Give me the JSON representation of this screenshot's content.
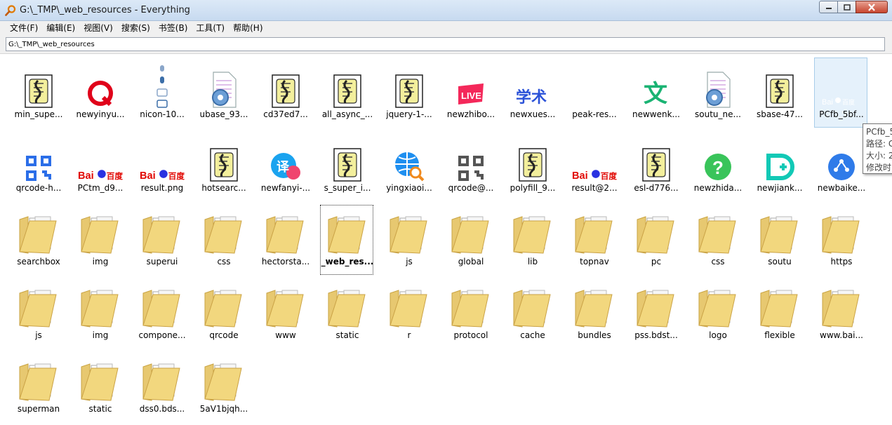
{
  "window": {
    "title": "G:\\_TMP\\_web_resources - Everything",
    "accent": "#c7daf0"
  },
  "menu": [
    {
      "label": "文件(F)"
    },
    {
      "label": "编辑(E)"
    },
    {
      "label": "视图(V)"
    },
    {
      "label": "搜索(S)"
    },
    {
      "label": "书签(B)"
    },
    {
      "label": "工具(T)"
    },
    {
      "label": "帮助(H)"
    }
  ],
  "search": {
    "value": "G:\\_TMP\\_web_resources"
  },
  "rows": [
    [
      {
        "name": "min_supe...",
        "icon": "script-icon"
      },
      {
        "name": "newyinyu...",
        "icon": "music-q-icon"
      },
      {
        "name": "nicon-10...",
        "icon": "icon-sprite"
      },
      {
        "name": "ubase_93...",
        "icon": "gear-doc-icon"
      },
      {
        "name": "cd37ed7...",
        "icon": "script-icon"
      },
      {
        "name": "all_async_...",
        "icon": "script-icon"
      },
      {
        "name": "jquery-1-...",
        "icon": "script-icon"
      },
      {
        "name": "newzhibo...",
        "icon": "live-icon"
      },
      {
        "name": "newxues...",
        "icon": "xueshu-icon"
      },
      {
        "name": "peak-res...",
        "icon": "blank-icon"
      },
      {
        "name": "newwenk...",
        "icon": "wenku-icon"
      },
      {
        "name": "soutu_ne...",
        "icon": "gear-doc-icon"
      },
      {
        "name": "sbase-47...",
        "icon": "script-icon"
      },
      {
        "name": "PCfb_5bf...",
        "icon": "baidu-white-icon",
        "state": "hovered"
      }
    ],
    [
      {
        "name": "qrcode-h...",
        "icon": "qrcode-blue-icon"
      },
      {
        "name": "PCtm_d9...",
        "icon": "baidu-logo-icon"
      },
      {
        "name": "result.png",
        "icon": "baidu-logo-icon"
      },
      {
        "name": "hotsearc...",
        "icon": "script-icon"
      },
      {
        "name": "newfanyi-...",
        "icon": "fanyi-icon"
      },
      {
        "name": "s_super_i...",
        "icon": "script-icon"
      },
      {
        "name": "yingxiaoi...",
        "icon": "globe-search-icon"
      },
      {
        "name": "qrcode@...",
        "icon": "qrcode-gray-icon"
      },
      {
        "name": "polyfill_9...",
        "icon": "script-icon"
      },
      {
        "name": "result@2...",
        "icon": "baidu-logo-icon"
      },
      {
        "name": "esl-d776...",
        "icon": "script-icon"
      },
      {
        "name": "newzhida...",
        "icon": "zhidao-icon"
      },
      {
        "name": "newjiank...",
        "icon": "jiankang-icon"
      },
      {
        "name": "newbaike...",
        "icon": "baike-icon"
      }
    ],
    [
      {
        "name": "searchbox",
        "icon": "folder-icon"
      },
      {
        "name": "img",
        "icon": "folder-icon"
      },
      {
        "name": "superui",
        "icon": "folder-icon"
      },
      {
        "name": "css",
        "icon": "folder-doc-icon"
      },
      {
        "name": "hectorsta...",
        "icon": "folder-doc-icon"
      },
      {
        "name": "_web_res...",
        "icon": "folder-icon",
        "state": "selected"
      },
      {
        "name": "js",
        "icon": "folder-doc-icon"
      },
      {
        "name": "global",
        "icon": "folder-icon"
      },
      {
        "name": "lib",
        "icon": "folder-doc-icon"
      },
      {
        "name": "topnav",
        "icon": "folder-icon"
      },
      {
        "name": "pc",
        "icon": "folder-icon"
      },
      {
        "name": "css",
        "icon": "folder-doc-icon"
      },
      {
        "name": "soutu",
        "icon": "folder-icon"
      },
      {
        "name": "https",
        "icon": "folder-icon"
      }
    ],
    [
      {
        "name": "js",
        "icon": "folder-doc-icon"
      },
      {
        "name": "img",
        "icon": "folder-icon"
      },
      {
        "name": "compone...",
        "icon": "folder-doc-icon"
      },
      {
        "name": "qrcode",
        "icon": "folder-icon"
      },
      {
        "name": "www",
        "icon": "folder-icon"
      },
      {
        "name": "static",
        "icon": "folder-icon"
      },
      {
        "name": "r",
        "icon": "folder-icon"
      },
      {
        "name": "protocol",
        "icon": "folder-icon"
      },
      {
        "name": "cache",
        "icon": "folder-icon"
      },
      {
        "name": "bundles",
        "icon": "folder-doc-icon"
      },
      {
        "name": "pss.bdst...",
        "icon": "folder-icon"
      },
      {
        "name": "logo",
        "icon": "folder-icon"
      },
      {
        "name": "flexible",
        "icon": "folder-icon"
      },
      {
        "name": "www.bai...",
        "icon": "folder-icon"
      }
    ],
    [
      {
        "name": "superman",
        "icon": "folder-icon"
      },
      {
        "name": "static",
        "icon": "folder-icon"
      },
      {
        "name": "dss0.bds...",
        "icon": "folder-doc-icon"
      },
      {
        "name": "5aV1bjqh...",
        "icon": "folder-icon"
      }
    ]
  ],
  "tooltip": {
    "lines": [
      "PCfb_5",
      "路径: G",
      "大小: 2",
      "修改时"
    ]
  }
}
